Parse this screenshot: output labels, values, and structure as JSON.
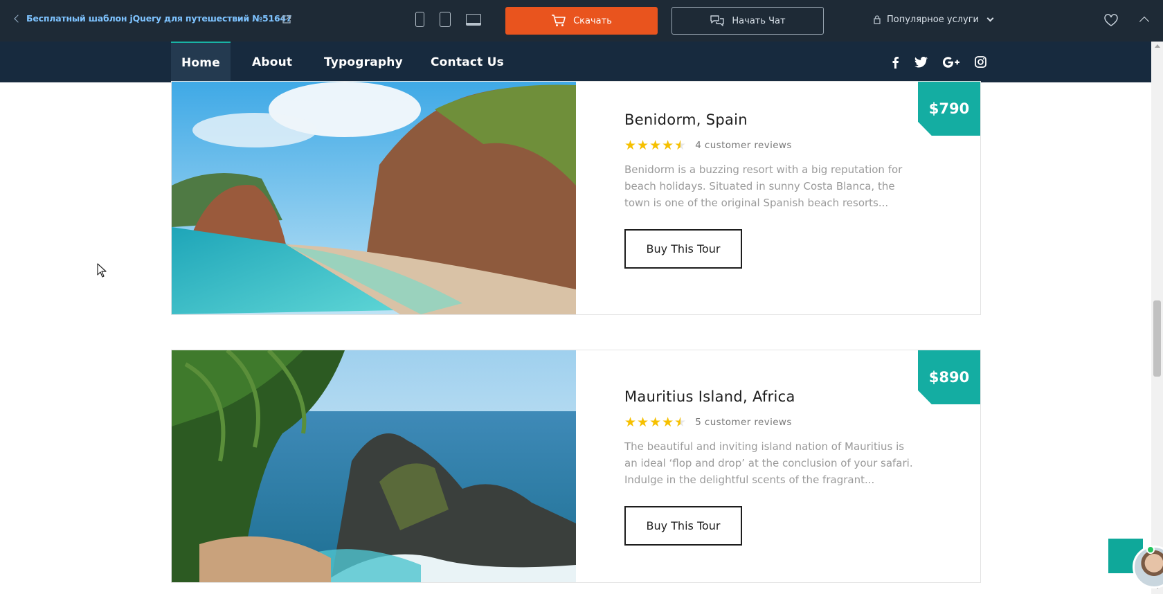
{
  "topbar": {
    "back_title": "Бесплатный шаблон jQuery для путешествий №51647",
    "download_label": "Скачать",
    "chat_label": "Начать Чат",
    "popular_label": "Популярное услуги"
  },
  "nav": {
    "items": [
      {
        "label": "Home",
        "active": true
      },
      {
        "label": "About",
        "active": false
      },
      {
        "label": "Typography",
        "active": false
      },
      {
        "label": "Contact Us",
        "active": false
      }
    ],
    "socials": [
      "facebook-icon",
      "twitter-icon",
      "google-plus-icon",
      "instagram-icon"
    ]
  },
  "tours": [
    {
      "title": "Benidorm, Spain",
      "price": "$790",
      "rating": 4.5,
      "reviews": "4 customer reviews",
      "description": "Benidorm is a buzzing resort with a big reputation for beach holidays. Situated in sunny Costa Blanca, the town is one of the original Spanish beach resorts...",
      "button": "Buy This Tour"
    },
    {
      "title": "Mauritius Island, Africa",
      "price": "$890",
      "rating": 4.5,
      "reviews": "5 customer reviews",
      "description": "The beautiful and inviting island nation of Mauritius is an ideal ‘flop and drop’ at the conclusion of your safari. Indulge in the delightful scents of the fragrant...",
      "button": "Buy This Tour"
    }
  ],
  "colors": {
    "topbar_bg": "#1e2a36",
    "nav_bg": "#172a3e",
    "accent_teal": "#14ada2",
    "download_orange": "#e9541e",
    "star_yellow": "#f6c000"
  }
}
